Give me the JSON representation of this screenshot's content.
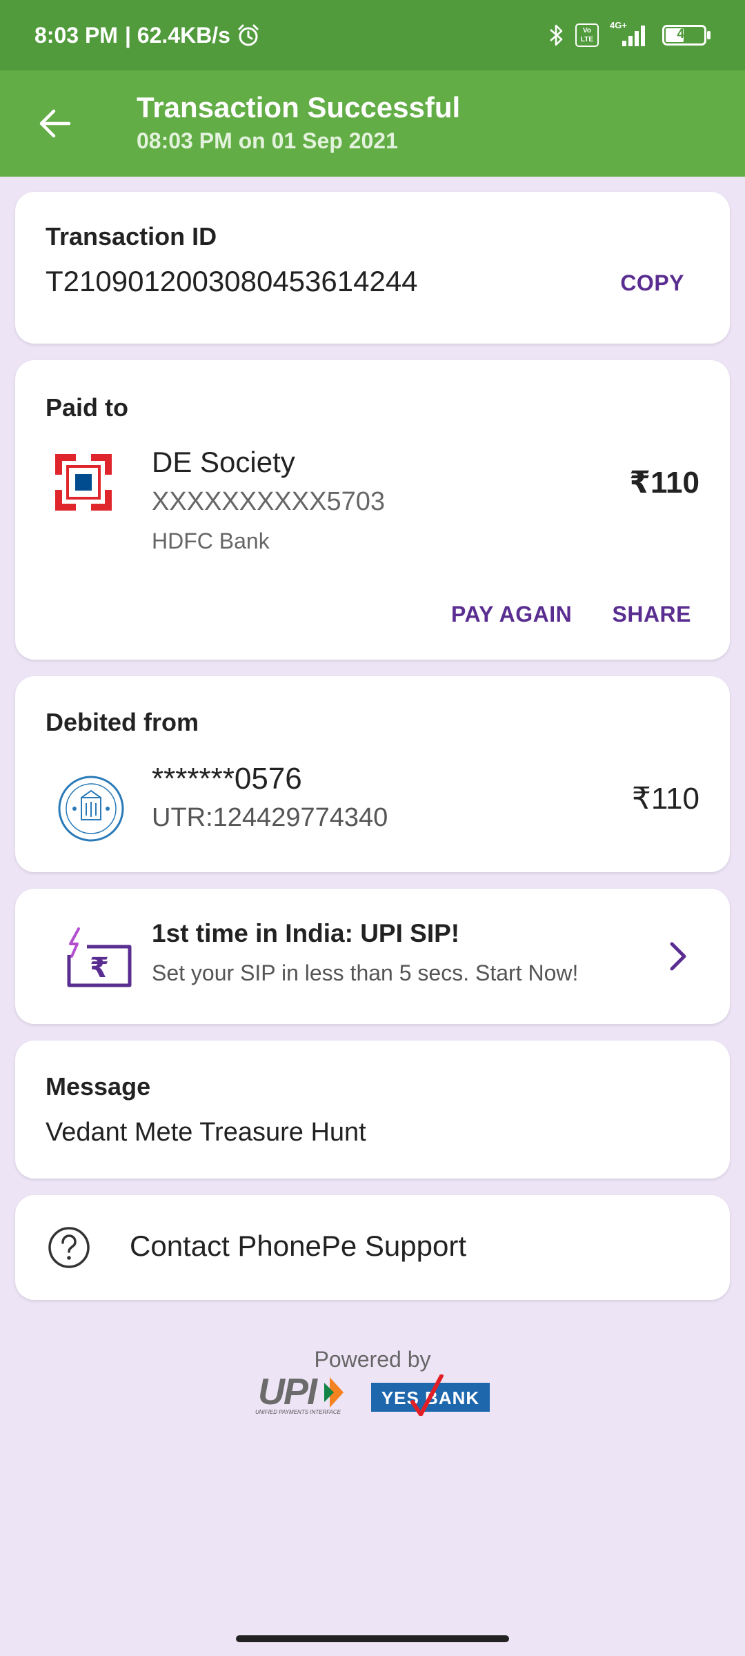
{
  "status_bar": {
    "time": "8:03 PM",
    "network_speed": "| 62.4KB/s",
    "network_type": "4G+",
    "volte": "Vo LTE",
    "battery": "40"
  },
  "header": {
    "title": "Transaction Successful",
    "subtitle": "08:03 PM on 01 Sep 2021"
  },
  "transaction": {
    "label": "Transaction ID",
    "id": "T2109012003080453614244",
    "copy_label": "COPY"
  },
  "paid_to": {
    "label": "Paid to",
    "name": "DE Society",
    "account": "XXXXXXXXXX5703",
    "bank": "HDFC Bank",
    "amount": "₹110",
    "pay_again_label": "PAY AGAIN",
    "share_label": "SHARE"
  },
  "debited_from": {
    "label": "Debited from",
    "account": "*******0576",
    "utr": "UTR:124429774340",
    "amount": "₹110"
  },
  "promo": {
    "title": "1st time in India: UPI SIP!",
    "subtitle": "Set your SIP in less than 5 secs. Start Now!"
  },
  "message": {
    "label": "Message",
    "text": "Vedant Mete Treasure Hunt"
  },
  "support": {
    "label": "Contact PhonePe Support"
  },
  "footer": {
    "powered_by": "Powered by",
    "upi_logo": "UPI",
    "upi_tagline": "UNIFIED PAYMENTS INTERFACE",
    "bank_logo": "YES BANK"
  },
  "colors": {
    "status_bar": "#519b3c",
    "app_bar": "#62ad46",
    "background": "#ede4f6",
    "accent_purple": "#5a2d91",
    "hdfc_red": "#e0262d",
    "hdfc_blue": "#004c8f"
  },
  "icons": [
    "back-arrow-icon",
    "alarm-icon",
    "bluetooth-icon",
    "volte-icon",
    "signal-icon",
    "battery-icon",
    "hdfc-logo",
    "sbi-logo",
    "sip-rupee-icon",
    "chevron-right-icon",
    "help-icon"
  ]
}
